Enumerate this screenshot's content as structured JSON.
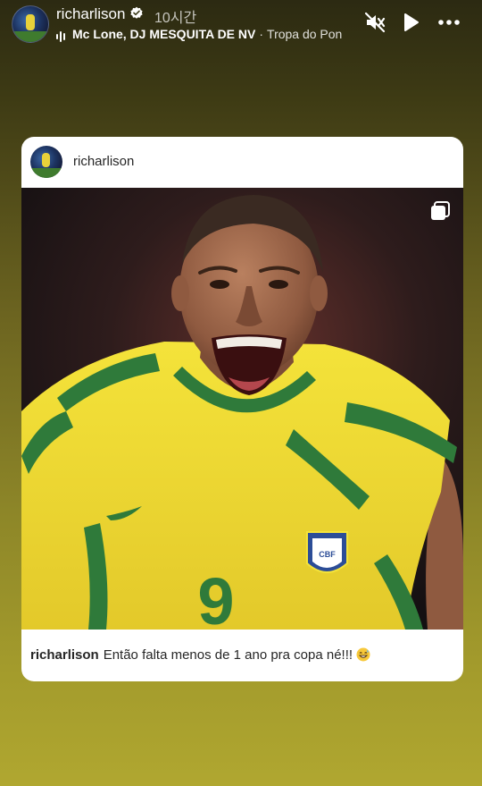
{
  "story": {
    "username": "richarlison",
    "time_ago": "10시간",
    "music": {
      "artist": "Mc Lone, DJ MESQUITA DE NV",
      "separator": "·",
      "track": "Tropa do Pon"
    },
    "controls": [
      "mute-icon",
      "play-icon",
      "more-icon"
    ]
  },
  "post": {
    "username": "richarlison",
    "caption": {
      "user": "richarlison",
      "text": "Então falta menos de 1 ano pra copa né!!!",
      "emoji": "😅"
    },
    "photo": {
      "jersey_number": "9",
      "badge_text": "CBF",
      "multi_image_icon": "carousel-icon"
    }
  },
  "colors": {
    "jersey_yellow": "#f2df2c",
    "jersey_green": "#2f7a3a",
    "text_dark": "#262626"
  }
}
